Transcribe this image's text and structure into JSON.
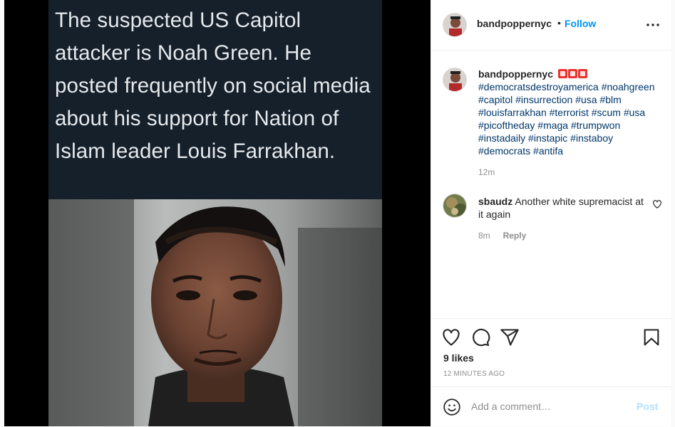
{
  "post": {
    "image_text": "The suspected US Capitol attacker is Noah Green. He posted frequently on social media about his support for Nation of Islam leader Louis Farrakhan."
  },
  "header": {
    "username": "bandpoppernyc",
    "separator": "•",
    "follow_label": "Follow"
  },
  "caption": {
    "username": "bandpoppernyc",
    "emoji": "🆘🆘🆘",
    "hashtags": "#democratsdestroyamerica #noahgreen #capitol #insurrection #usa #blm #louisfarrakhan #terrorist #scum #usa #picoftheday #maga #trumpwon #instadaily #instapic #instaboy #democrats #antifa",
    "time": "12m"
  },
  "comments": [
    {
      "username": "sbaudz",
      "text": "Another white supremacist at it again",
      "time": "8m",
      "reply_label": "Reply"
    }
  ],
  "stats": {
    "likes": "9 likes",
    "posted": "12 MINUTES AGO"
  },
  "comment_box": {
    "placeholder": "Add a comment…",
    "post_label": "Post"
  },
  "icons": [
    "more-icon",
    "heart-icon",
    "comment-icon",
    "share-icon",
    "bookmark-icon",
    "emoji-icon",
    "small-heart-icon"
  ],
  "colors": {
    "link": "#0095f6",
    "hashtag": "#00376b",
    "muted": "#8e8e8e",
    "post_disabled": "#b2dffc",
    "tweet_bg": "#15202b"
  }
}
